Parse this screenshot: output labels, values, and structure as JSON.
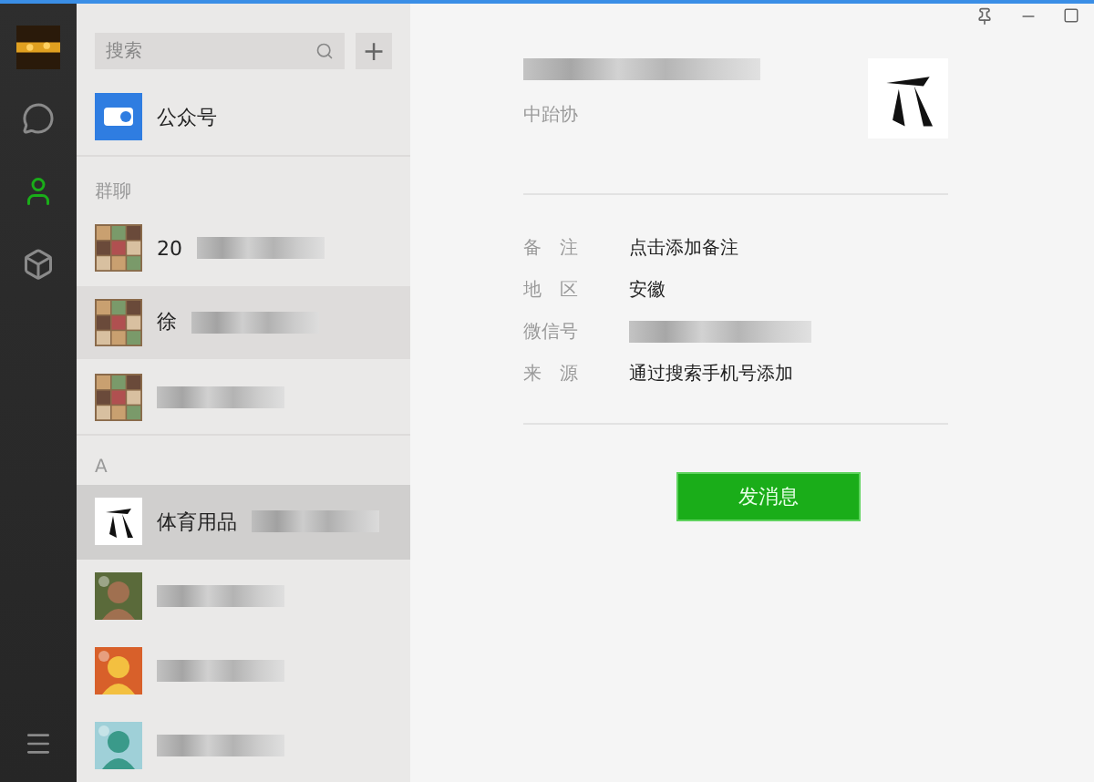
{
  "nav": {
    "items": [
      {
        "kind": "chat",
        "selected": false
      },
      {
        "kind": "contacts",
        "selected": true
      },
      {
        "kind": "box",
        "selected": false
      }
    ]
  },
  "search": {
    "placeholder": "搜索",
    "add": "+"
  },
  "list": [
    {
      "kind": "contact",
      "name": "公众号",
      "blurred": false,
      "selected": false,
      "hovered": false
    },
    {
      "kind": "header",
      "name": "群聊"
    },
    {
      "kind": "contact",
      "name": "20",
      "blurred": true,
      "selected": false,
      "hovered": false
    },
    {
      "kind": "contact",
      "name": "徐",
      "blurred": true,
      "selected": false,
      "hovered": true
    },
    {
      "kind": "contact",
      "blurred": true,
      "selected": false,
      "hovered": false
    },
    {
      "kind": "header",
      "name": "A"
    },
    {
      "kind": "contact",
      "name": "体育用品",
      "blurred": true,
      "selected": true,
      "hovered": false
    },
    {
      "kind": "contact",
      "blurred": true,
      "selected": false,
      "hovered": false
    },
    {
      "kind": "contact",
      "blurred": true,
      "selected": false,
      "hovered": false
    },
    {
      "kind": "contact",
      "blurred": true,
      "selected": false,
      "hovered": false
    }
  ],
  "profile": {
    "name_blurred": true,
    "subtitle": "中跆协",
    "fields": [
      {
        "label": "备　注",
        "value": "点击添加备注",
        "blurred": false
      },
      {
        "label": "地　区",
        "value": "安徽",
        "blurred": false
      },
      {
        "label": "微信号",
        "blurred": true
      },
      {
        "label": "来　源",
        "value": "通过搜索手机号添加",
        "blurred": false
      }
    ],
    "button": "发消息"
  }
}
